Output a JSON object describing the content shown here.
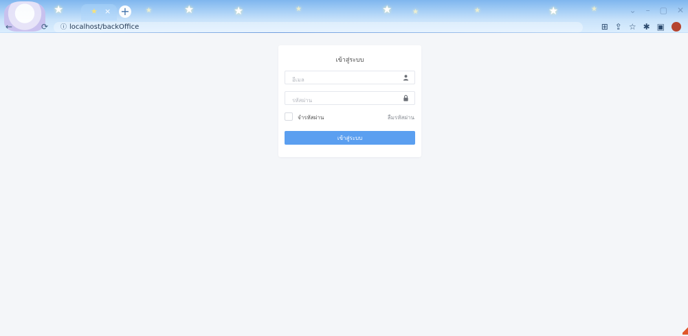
{
  "browser": {
    "tab_close_glyph": "×",
    "new_tab_glyph": "+",
    "url": "localhost/backOffice",
    "window_controls": [
      "⌄",
      "–",
      "▢",
      "✕"
    ]
  },
  "login": {
    "title": "เข้าสู่ระบบ",
    "email_placeholder": "อีเมล",
    "password_placeholder": "รหัสผ่าน",
    "remember_label": "จำรหัสผ่าน",
    "forgot_label": "ลืมรหัสผ่าน",
    "submit_label": "เข้าสู่ระบบ",
    "button_color": "#5b9ff0"
  },
  "icons": {
    "email_field": "user-icon",
    "password_field": "lock-icon"
  }
}
